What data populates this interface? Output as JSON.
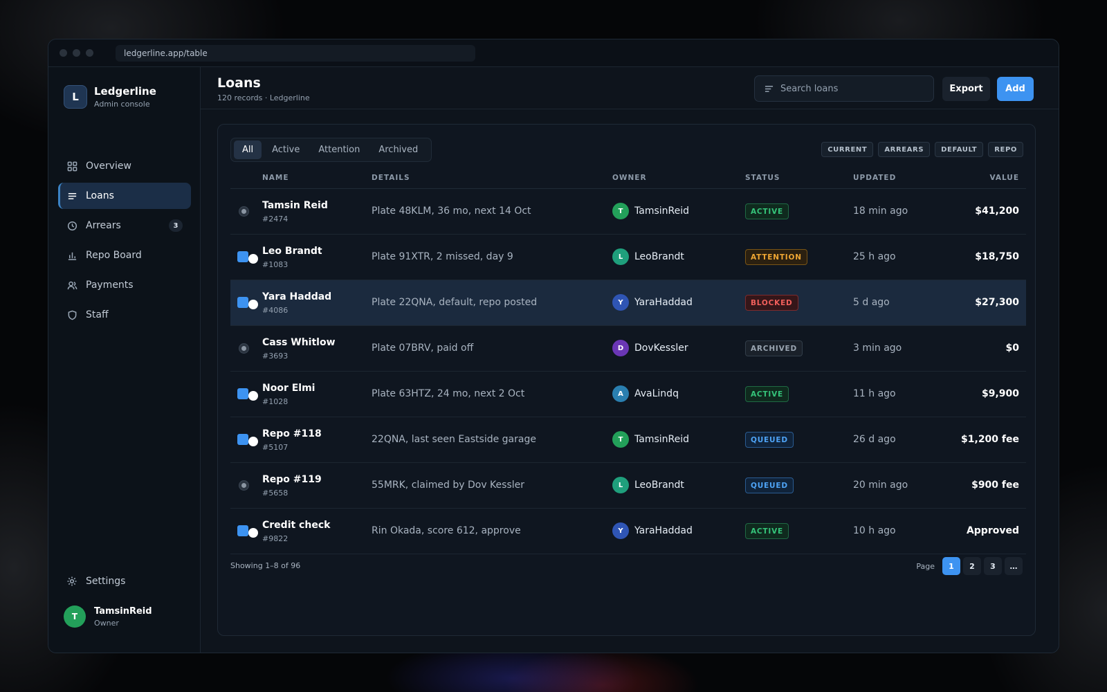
{
  "browser": {
    "url": "ledgerline.app/table"
  },
  "brand": {
    "logo_letter": "L",
    "name": "Ledgerline",
    "subtitle": "Admin console"
  },
  "sidebar": {
    "items": [
      {
        "label": "Overview",
        "icon": "grid-icon"
      },
      {
        "label": "Loans",
        "icon": "list-icon",
        "active": true
      },
      {
        "label": "Arrears",
        "icon": "clock-icon",
        "badge": "3"
      },
      {
        "label": "Repo Board",
        "icon": "bar-chart-icon"
      },
      {
        "label": "Payments",
        "icon": "users-icon"
      },
      {
        "label": "Staff",
        "icon": "shield-icon"
      }
    ],
    "settings_label": "Settings",
    "user": {
      "initial": "T",
      "name": "TamsinReid",
      "role": "Owner"
    }
  },
  "header": {
    "title": "Loans",
    "subtitle": "120 records · Ledgerline",
    "search_placeholder": "Search loans",
    "export_label": "Export",
    "add_label": "Add"
  },
  "tabs": [
    "All",
    "Active",
    "Attention",
    "Archived"
  ],
  "filter_chips": [
    "CURRENT",
    "ARREARS",
    "DEFAULT",
    "REPO"
  ],
  "table": {
    "columns": {
      "name": "NAME",
      "details": "DETAILS",
      "owner": "OWNER",
      "status": "STATUS",
      "updated": "UPDATED",
      "value": "VALUE"
    },
    "rows": [
      {
        "name": "Tamsin Reid",
        "id": "#2474",
        "details": "Plate 48KLM, 36 mo, next 14 Oct",
        "owner": "TamsinReid",
        "owner_initial": "T",
        "owner_color": "#23a05a",
        "status": "ACTIVE",
        "updated": "18 min ago",
        "value": "$41,200",
        "toggle": false,
        "selected": false
      },
      {
        "name": "Leo Brandt",
        "id": "#1083",
        "details": "Plate 91XTR, 2 missed, day 9",
        "owner": "LeoBrandt",
        "owner_initial": "L",
        "owner_color": "#1f9f7c",
        "status": "ATTENTION",
        "updated": "25 h ago",
        "value": "$18,750",
        "toggle": true,
        "selected": false
      },
      {
        "name": "Yara Haddad",
        "id": "#4086",
        "details": "Plate 22QNA, default, repo posted",
        "owner": "YaraHaddad",
        "owner_initial": "Y",
        "owner_color": "#2f55b4",
        "status": "BLOCKED",
        "updated": "5 d ago",
        "value": "$27,300",
        "toggle": true,
        "selected": true
      },
      {
        "name": "Cass Whitlow",
        "id": "#3693",
        "details": "Plate 07BRV, paid off",
        "owner": "DovKessler",
        "owner_initial": "D",
        "owner_color": "#6a36b5",
        "status": "ARCHIVED",
        "updated": "3 min ago",
        "value": "$0",
        "toggle": false,
        "selected": false
      },
      {
        "name": "Noor Elmi",
        "id": "#1028",
        "details": "Plate 63HTZ, 24 mo, next 2 Oct",
        "owner": "AvaLindq",
        "owner_initial": "A",
        "owner_color": "#2a7fb0",
        "status": "ACTIVE",
        "updated": "11 h ago",
        "value": "$9,900",
        "toggle": true,
        "selected": false
      },
      {
        "name": "Repo #118",
        "id": "#5107",
        "details": "22QNA, last seen Eastside garage",
        "owner": "TamsinReid",
        "owner_initial": "T",
        "owner_color": "#23a05a",
        "status": "QUEUED",
        "updated": "26 d ago",
        "value": "$1,200 fee",
        "toggle": true,
        "selected": false
      },
      {
        "name": "Repo #119",
        "id": "#5658",
        "details": "55MRK, claimed by Dov Kessler",
        "owner": "LeoBrandt",
        "owner_initial": "L",
        "owner_color": "#1f9f7c",
        "status": "QUEUED",
        "updated": "20 min ago",
        "value": "$900 fee",
        "toggle": false,
        "selected": false
      },
      {
        "name": "Credit check",
        "id": "#9822",
        "details": "Rin Okada, score 612, approve",
        "owner": "YaraHaddad",
        "owner_initial": "Y",
        "owner_color": "#2f55b4",
        "status": "ACTIVE",
        "updated": "10 h ago",
        "value": "Approved",
        "toggle": true,
        "selected": false
      }
    ]
  },
  "footer": {
    "showing": "Showing 1–8 of 96",
    "page_label": "Page",
    "pages": [
      "1",
      "2",
      "3",
      "…"
    ],
    "current_page": "1"
  },
  "colors": {
    "accent": "#3d93f1",
    "active": "#35c47a",
    "attention": "#f0a733",
    "blocked": "#f3605c",
    "queued": "#4ea3f5",
    "archived": "#9aa5b1"
  }
}
